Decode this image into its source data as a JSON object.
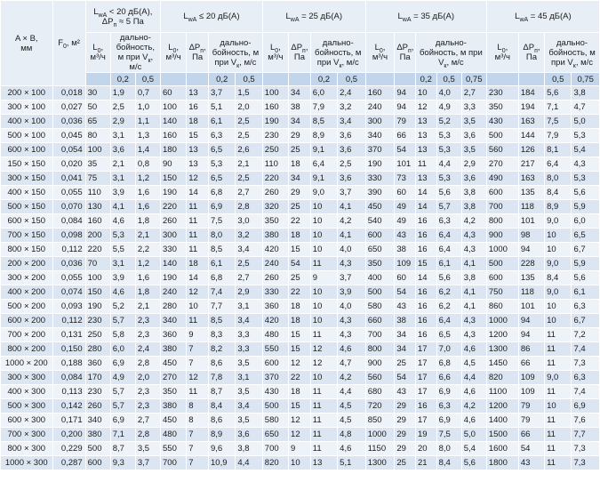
{
  "header": {
    "ab_label": "A × B,",
    "ab_unit": "мм",
    "f_label": "F",
    "f_sub": "0",
    "f_unit": ", м²",
    "groups": [
      {
        "line1": "L",
        "line1_sub": "wA",
        "line1_rest": " < 20 дБ(А),",
        "line2": "ΔP",
        "line2_sub": "п",
        "line2_rest": " ≈ 5 Па"
      },
      {
        "line1": "L",
        "line1_sub": "wA",
        "line1_rest": " ≤ 20 дБ(А)"
      },
      {
        "line1": "L",
        "line1_sub": "wA",
        "line1_rest": " = 25 дБ(А)"
      },
      {
        "line1": "L",
        "line1_sub": "wA",
        "line1_rest": " = 35 дБ(А)"
      },
      {
        "line1": "L",
        "line1_sub": "wA",
        "line1_rest": " = 45 дБ(А)"
      }
    ],
    "l0": {
      "main": "L",
      "sub": "0",
      "rest": ",",
      "unit": "м³/ч"
    },
    "dp": {
      "main": "ΔP",
      "sub": "п",
      "rest": ",",
      "unit": "Па"
    },
    "reach": {
      "text": "дально-бойность, м при V",
      "sub": "к",
      "rest": ", м/с"
    },
    "velocities": {
      "g1": [
        "0,2",
        "0,5"
      ],
      "g2": [
        "0,2",
        "0,5"
      ],
      "g3": [
        "0,2",
        "0,5"
      ],
      "g4": [
        "0,2",
        "0,5",
        "0,75"
      ],
      "g5": [
        "0,5",
        "0,75"
      ]
    }
  },
  "rows": [
    [
      "200 × 100",
      "0,018",
      "30",
      "1,9",
      "0,7",
      "60",
      "13",
      "3,7",
      "1,5",
      "100",
      "34",
      "6,0",
      "2,4",
      "160",
      "94",
      "10",
      "4,0",
      "2,7",
      "230",
      "184",
      "5,6",
      "3,8"
    ],
    [
      "300 × 100",
      "0,027",
      "50",
      "2,5",
      "1,0",
      "100",
      "16",
      "5,1",
      "2,0",
      "160",
      "38",
      "7,9",
      "3,2",
      "240",
      "94",
      "12",
      "4,9",
      "3,3",
      "350",
      "194",
      "7,1",
      "4,7"
    ],
    [
      "400 × 100",
      "0,036",
      "65",
      "2,9",
      "1,1",
      "140",
      "18",
      "6,1",
      "2,5",
      "190",
      "34",
      "8,5",
      "3,4",
      "300",
      "79",
      "13",
      "5,2",
      "3,5",
      "430",
      "163",
      "7,5",
      "5,0"
    ],
    [
      "500 × 100",
      "0,045",
      "80",
      "3,1",
      "1,3",
      "160",
      "15",
      "6,3",
      "2,5",
      "230",
      "29",
      "8,9",
      "3,6",
      "340",
      "66",
      "13",
      "5,3",
      "3,6",
      "500",
      "144",
      "7,9",
      "5,3"
    ],
    [
      "600 × 100",
      "0,054",
      "100",
      "3,6",
      "1,4",
      "180",
      "13",
      "6,5",
      "2,6",
      "250",
      "25",
      "9,1",
      "3,6",
      "370",
      "54",
      "13",
      "5,3",
      "3,5",
      "560",
      "126",
      "8,1",
      "5,4"
    ],
    [
      "150 × 150",
      "0,020",
      "35",
      "2,1",
      "0,8",
      "90",
      "13",
      "5,3",
      "2,1",
      "110",
      "18",
      "6,4",
      "2,5",
      "190",
      "101",
      "11",
      "4,4",
      "2,9",
      "270",
      "217",
      "6,4",
      "4,3"
    ],
    [
      "300 × 150",
      "0,041",
      "75",
      "3,1",
      "1,2",
      "150",
      "12",
      "6,5",
      "2,5",
      "220",
      "34",
      "9,1",
      "3,6",
      "330",
      "73",
      "13",
      "5,3",
      "3,6",
      "490",
      "163",
      "8,0",
      "5,3"
    ],
    [
      "400 × 150",
      "0,055",
      "110",
      "3,9",
      "1,6",
      "190",
      "14",
      "6,8",
      "2,7",
      "260",
      "29",
      "9,0",
      "3,7",
      "390",
      "60",
      "14",
      "5,6",
      "3,8",
      "600",
      "135",
      "8,4",
      "5,6"
    ],
    [
      "500 × 150",
      "0,070",
      "130",
      "4,1",
      "1,6",
      "220",
      "11",
      "6,9",
      "2,8",
      "320",
      "25",
      "10",
      "4,1",
      "450",
      "49",
      "14",
      "5,7",
      "3,8",
      "700",
      "118",
      "8,9",
      "5,9"
    ],
    [
      "600 × 150",
      "0,084",
      "160",
      "4,6",
      "1,8",
      "260",
      "11",
      "7,5",
      "3,0",
      "350",
      "22",
      "10",
      "4,2",
      "540",
      "49",
      "16",
      "6,3",
      "4,2",
      "800",
      "101",
      "9,0",
      "6,0"
    ],
    [
      "700 × 150",
      "0,098",
      "200",
      "5,3",
      "2,1",
      "300",
      "11",
      "8,0",
      "3,2",
      "380",
      "18",
      "10",
      "4,1",
      "600",
      "43",
      "16",
      "6,4",
      "4,3",
      "900",
      "98",
      "10",
      "6,5"
    ],
    [
      "800 × 150",
      "0,112",
      "220",
      "5,5",
      "2,2",
      "330",
      "11",
      "8,5",
      "3,4",
      "420",
      "15",
      "10",
      "4,0",
      "650",
      "38",
      "16",
      "6,4",
      "4,3",
      "1000",
      "94",
      "10",
      "6,7"
    ],
    [
      "200 × 200",
      "0,036",
      "70",
      "3,1",
      "1,2",
      "140",
      "18",
      "6,1",
      "2,5",
      "240",
      "54",
      "11",
      "4,3",
      "350",
      "109",
      "15",
      "6,1",
      "4,1",
      "500",
      "228",
      "9,0",
      "5,9"
    ],
    [
      "300 × 200",
      "0,055",
      "100",
      "3,9",
      "1,6",
      "190",
      "14",
      "6,8",
      "2,7",
      "260",
      "25",
      "9",
      "3,7",
      "400",
      "60",
      "14",
      "5,6",
      "3,8",
      "600",
      "135",
      "8,4",
      "5,6"
    ],
    [
      "400 × 200",
      "0,074",
      "150",
      "4,6",
      "1,8",
      "240",
      "12",
      "7,4",
      "2,9",
      "330",
      "22",
      "10",
      "3,9",
      "500",
      "54",
      "16",
      "6,2",
      "4,1",
      "750",
      "118",
      "9,0",
      "6,1"
    ],
    [
      "500 × 200",
      "0,093",
      "190",
      "5,2",
      "2,1",
      "280",
      "10",
      "7,7",
      "3,1",
      "360",
      "18",
      "10",
      "4,0",
      "580",
      "43",
      "16",
      "6,2",
      "4,1",
      "860",
      "101",
      "10",
      "6,3"
    ],
    [
      "600 × 200",
      "0,112",
      "230",
      "5,7",
      "2,3",
      "340",
      "11",
      "8,5",
      "3,4",
      "420",
      "18",
      "10",
      "4,3",
      "660",
      "38",
      "16",
      "6,4",
      "4,3",
      "1000",
      "94",
      "10",
      "6,7"
    ],
    [
      "700 × 200",
      "0,131",
      "250",
      "5,8",
      "2,3",
      "360",
      "9",
      "8,3",
      "3,3",
      "480",
      "15",
      "11",
      "4,3",
      "700",
      "34",
      "16",
      "6,5",
      "4,3",
      "1200",
      "94",
      "11",
      "7,2"
    ],
    [
      "800 × 200",
      "0,150",
      "280",
      "6,0",
      "2,4",
      "380",
      "7",
      "8,2",
      "3,3",
      "550",
      "15",
      "12",
      "4,6",
      "800",
      "34",
      "17",
      "7,0",
      "4,6",
      "1300",
      "86",
      "11",
      "7,4"
    ],
    [
      "1000 × 200",
      "0,188",
      "360",
      "6,9",
      "2,8",
      "450",
      "7",
      "8,6",
      "3,5",
      "600",
      "12",
      "12",
      "4,7",
      "900",
      "25",
      "17",
      "6,8",
      "4,5",
      "1450",
      "66",
      "11",
      "7,3"
    ],
    [
      "300 × 300",
      "0,084",
      "170",
      "4,9",
      "2,0",
      "270",
      "12",
      "7,8",
      "3,1",
      "370",
      "22",
      "10",
      "4,2",
      "560",
      "54",
      "17",
      "6,6",
      "4,4",
      "820",
      "109",
      "9,0",
      "6,3"
    ],
    [
      "400 × 300",
      "0,113",
      "230",
      "5,7",
      "2,3",
      "350",
      "11",
      "8,7",
      "3,5",
      "430",
      "18",
      "11",
      "4,4",
      "680",
      "43",
      "17",
      "6,9",
      "4,6",
      "1100",
      "109",
      "11",
      "7,4"
    ],
    [
      "500 × 300",
      "0,142",
      "260",
      "5,7",
      "2,3",
      "380",
      "8",
      "8,4",
      "3,4",
      "500",
      "15",
      "11",
      "4,5",
      "720",
      "29",
      "16",
      "6,3",
      "4,2",
      "1200",
      "79",
      "10",
      "6,9"
    ],
    [
      "600 × 300",
      "0,171",
      "340",
      "6,9",
      "2,7",
      "450",
      "8",
      "8,6",
      "3,5",
      "580",
      "12",
      "11",
      "4,5",
      "850",
      "29",
      "17",
      "6,9",
      "4,6",
      "1400",
      "79",
      "11",
      "7,6"
    ],
    [
      "700 × 300",
      "0,200",
      "380",
      "7,1",
      "2,8",
      "480",
      "7",
      "8,9",
      "3,6",
      "650",
      "12",
      "11",
      "4,8",
      "1000",
      "29",
      "19",
      "7,5",
      "5,0",
      "1500",
      "66",
      "11",
      "7,7"
    ],
    [
      "800 × 300",
      "0,229",
      "500",
      "8,7",
      "3,5",
      "550",
      "7",
      "9,6",
      "3,8",
      "700",
      "9",
      "11",
      "4,6",
      "1150",
      "29",
      "20",
      "8,0",
      "5,4",
      "1600",
      "54",
      "11",
      "7,3"
    ],
    [
      "1000 × 300",
      "0,287",
      "600",
      "9,3",
      "3,7",
      "700",
      "7",
      "10,9",
      "4,4",
      "820",
      "10",
      "13",
      "5,1",
      "1300",
      "25",
      "21",
      "8,4",
      "5,6",
      "1800",
      "43",
      "11",
      "7,3"
    ]
  ]
}
